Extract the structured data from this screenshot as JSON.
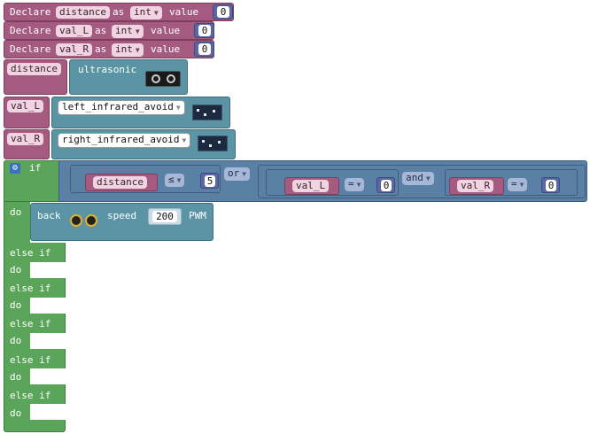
{
  "declares": [
    {
      "keyword": "Declare",
      "var": "distance",
      "as": "as",
      "type": "int",
      "value_label": "value",
      "value": "0"
    },
    {
      "keyword": "Declare",
      "var": "val_L",
      "as": "as",
      "type": "int",
      "value_label": "value",
      "value": "0"
    },
    {
      "keyword": "Declare",
      "var": "val_R",
      "as": "as",
      "type": "int",
      "value_label": "value",
      "value": "0"
    }
  ],
  "assign_distance": {
    "var": "distance",
    "sensor": "ultrasonic"
  },
  "assign_val_l": {
    "var": "val_L",
    "sensor": "left_infrared_avoid"
  },
  "assign_val_r": {
    "var": "val_R",
    "sensor": "right_infrared_avoid"
  },
  "if_block": {
    "if_label": "if",
    "cond1": {
      "var": "distance",
      "op": "≤",
      "value": "5"
    },
    "or_label": "or",
    "cond2": {
      "var": "val_L",
      "op": "=",
      "value": "0"
    },
    "and_label": "and",
    "cond3": {
      "var": "val_R",
      "op": "=",
      "value": "0"
    },
    "do_label": "do",
    "action": {
      "cmd": "back",
      "speed_label": "speed",
      "speed": "200",
      "unit": "PWM"
    },
    "else_if_label": "else if",
    "else_branches": 5
  }
}
